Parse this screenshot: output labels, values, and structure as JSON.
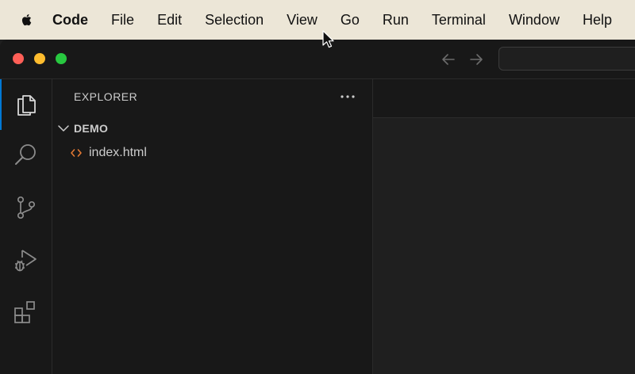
{
  "menubar": {
    "app_name": "Code",
    "items": [
      "File",
      "Edit",
      "Selection",
      "View",
      "Go",
      "Run",
      "Terminal",
      "Window",
      "Help"
    ]
  },
  "window": {
    "traffic_lights": {
      "close": "#ff5f57",
      "minimize": "#febc2e",
      "zoom": "#28c840"
    },
    "command_center_value": ""
  },
  "activity_bar": {
    "items": [
      "explorer-icon",
      "search-icon",
      "source-control-icon",
      "run-debug-icon",
      "extensions-icon"
    ],
    "active": "explorer-icon",
    "accent": "#0078d4"
  },
  "sidebar": {
    "title": "EXPLORER",
    "folder": {
      "name": "DEMO",
      "expanded": true,
      "files": [
        {
          "name": "index.html",
          "icon": "html-file-icon",
          "icon_color": "#e37933"
        }
      ]
    }
  }
}
